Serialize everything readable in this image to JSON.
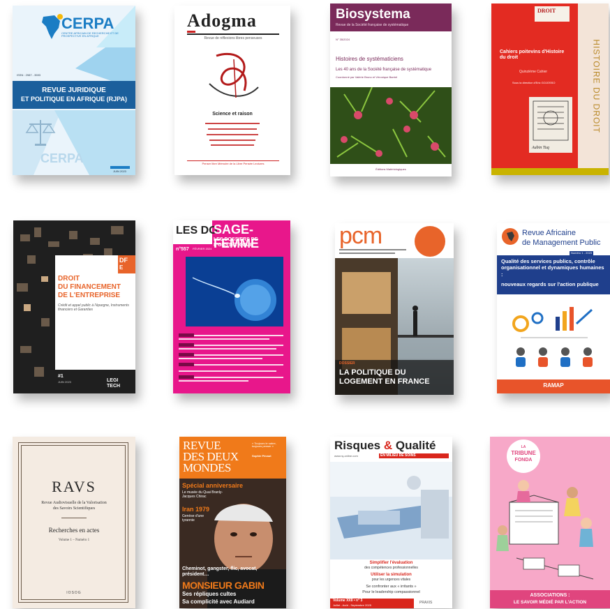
{
  "covers": [
    {
      "name": "CERPA",
      "org": "CERPA",
      "org_sub": "CENTRE AFRICAIN DE RECHERCHE ET DE PROSPECTIVE EN AFRIQUE",
      "issn": "ISSN : 2987 - 3593",
      "title_line1": "REVUE JURIDIQUE",
      "title_line2": "ET POLITIQUE EN AFRIQUE (RJPA)",
      "date": "JUIN 2023",
      "watermark": "CERPA"
    },
    {
      "name": "Adogma",
      "title": "Adogma",
      "subtitle": "Revue de réflexions libres penseuses",
      "headline": "Science et raison",
      "footer": "Penser libre  Mémoire de la Libre Pensée  Lectures"
    },
    {
      "name": "Biosystema",
      "title": "Biosystema",
      "subtitle": "Revue de la Société française de systématique",
      "issue": "N° 35/2024",
      "headline": "Histoires de systématiciens",
      "subhead": "Les 40 ans de la Société française de systématique",
      "byline": "Coordonné par Valérie Bruno et Véronique Barriel",
      "publisher": "Éditions Matériologiques"
    },
    {
      "name": "Droit",
      "logo": "DROIT",
      "title": "Cahiers poitevins d'Histoire du droit",
      "issue": "Quinzième Cahier",
      "direction": "Sous la direction d'Eric GOJOSSO",
      "spine": "HISTOIRE DU DROIT",
      "sticker": "Aubin Tuq"
    },
    {
      "name": "DFE",
      "badge_line1": "DF",
      "badge_line2": "E",
      "title_line1": "DROIT",
      "title_line2": "DU FINANCEMENT",
      "title_line3": "DE L'ENTREPRISE",
      "subtitle": "Crédit et appel public à l'épargne, Instruments financiers et Garanties",
      "issue": "#1",
      "date": "JUIN 2023",
      "logo": "LEGI TECH"
    },
    {
      "name": "Sage-Femme",
      "brand": "LES DO",
      "title": "SAGE-FEMME",
      "subtitle": "LES DOSSIERS DE L'OBSTÉTRIQUE",
      "issue": "n°557",
      "date": "FÉVRIER 2024"
    },
    {
      "name": "PCM",
      "logo": "pcm",
      "kicker": "DOSSIER",
      "title_line1": "LA POLITIQUE DU",
      "title_line2": "LOGEMENT EN FRANCE"
    },
    {
      "name": "RAMAP",
      "title_line1": "Revue Africaine",
      "title_line2": "de Management Public",
      "issue": "Numéro 1 - 2023",
      "headline": "Qualité des services publics, contrôle organisationnel et dynamiques humaines :",
      "headline_em": "nouveaux regards sur l'action publique",
      "footer": "RAMAP"
    },
    {
      "name": "RAVS",
      "title": "RAVS",
      "subtitle_line1": "Revue Audiovisuelle de la Valorisation",
      "subtitle_line2": "des Savoirs Scientifiques",
      "section": "Recherches en actes",
      "volume": "Volume 1 – Numéro 1",
      "publisher": "IOSOG"
    },
    {
      "name": "Revue des Deux Mondes",
      "title_line1": "REVUE",
      "title_line2": "DES DEUX",
      "title_line3": "MONDES",
      "aside": "« Toujours le sabre, toujours penser »",
      "aside_author": "Sophie Pécaut",
      "special": "Spécial anniversaire",
      "special_sub": "Le musée du Quai Branly-Jacques Chirac",
      "iran": "Iran 1979",
      "iran_sub": "Genèse d'une tyrannie",
      "teaser": "Cheminot, gangster, flic, avocat, président…",
      "name_big": "MONSIEUR GABIN",
      "tag_line1": "Ses répliques cultes",
      "tag_line2": "Sa complicité avec Audiard"
    },
    {
      "name": "Risques & Qualité",
      "title_part1": "Risques ",
      "title_amp": "&",
      "title_part2": " Qualité",
      "tagline": "EN MILIEU DE SOINS",
      "site": "www.rq-online.com",
      "line1": "Simplifier l'évaluation",
      "line2": "des compétences professionnelles",
      "line3": "Utiliser la simulation",
      "line4": "pour les urgences vitales",
      "line5": "Se confronter aux « irritants »",
      "line6": "Pour le leadership compassionnel",
      "volume": "Volume XXII • n° 3",
      "date": "Juillet - Août - Septembre 2025",
      "publisher": "PRAXIS"
    },
    {
      "name": "La Tribune Fonda",
      "title_line1": "LA",
      "title_line2": "TRIBUNE",
      "title_line3": "FONDA",
      "footer_line1": "ASSOCIATIONS :",
      "footer_line2": "LE SAVOIR MÉDIÉ PAR L'ACTION"
    }
  ],
  "colors": {
    "cerpa_band": "#1b5f9c",
    "adogma_red": "#cc2222",
    "biosystema": "#7a2a5a",
    "droit_red": "#e32b22",
    "sage_femme": "#e8178b",
    "pcm_orange": "#e8642a",
    "ramap_blue": "#1f3f8c",
    "ramap_orange": "#e8542a",
    "rdm_orange": "#f07a1a",
    "rq_red": "#d9261c",
    "fonda_pink": "#f7a8c8"
  }
}
